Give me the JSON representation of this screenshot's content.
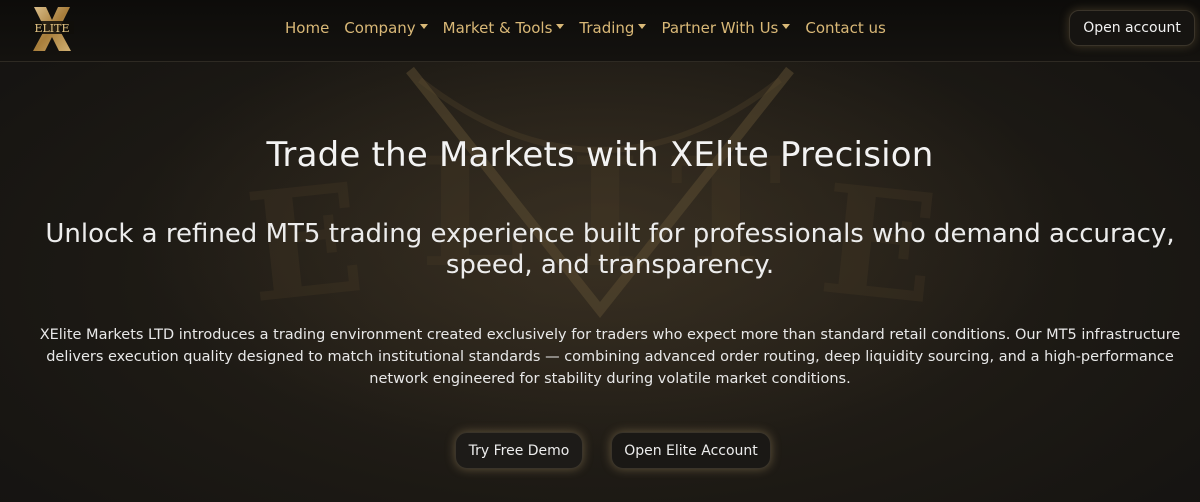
{
  "brand": {
    "logo_letter": "X",
    "logo_word": "ELITE"
  },
  "nav": {
    "items": [
      {
        "label": "Home",
        "dropdown": false
      },
      {
        "label": "Company",
        "dropdown": true
      },
      {
        "label": "Market & Tools",
        "dropdown": true
      },
      {
        "label": "Trading",
        "dropdown": true
      },
      {
        "label": "Partner With Us",
        "dropdown": true
      },
      {
        "label": "Contact us",
        "dropdown": false
      }
    ],
    "cta_label": "Open account"
  },
  "hero": {
    "title": "Trade the Markets with XElite Precision",
    "subtitle": "Unlock a refined MT5 trading experience built for professionals who demand accuracy, speed, and transparency.",
    "body": "XElite Markets LTD introduces a trading environment created exclusively for traders who expect more than standard retail conditions. Our MT5 infrastructure delivers execution quality designed to match institutional standards — combining advanced order routing, deep liquidity sourcing, and a high-performance network engineered for stability during volatile market conditions.",
    "primary_button": "Try Free Demo",
    "secondary_button": "Open Elite Account"
  },
  "colors": {
    "gold": "#d9b877",
    "background": "#15130f"
  }
}
